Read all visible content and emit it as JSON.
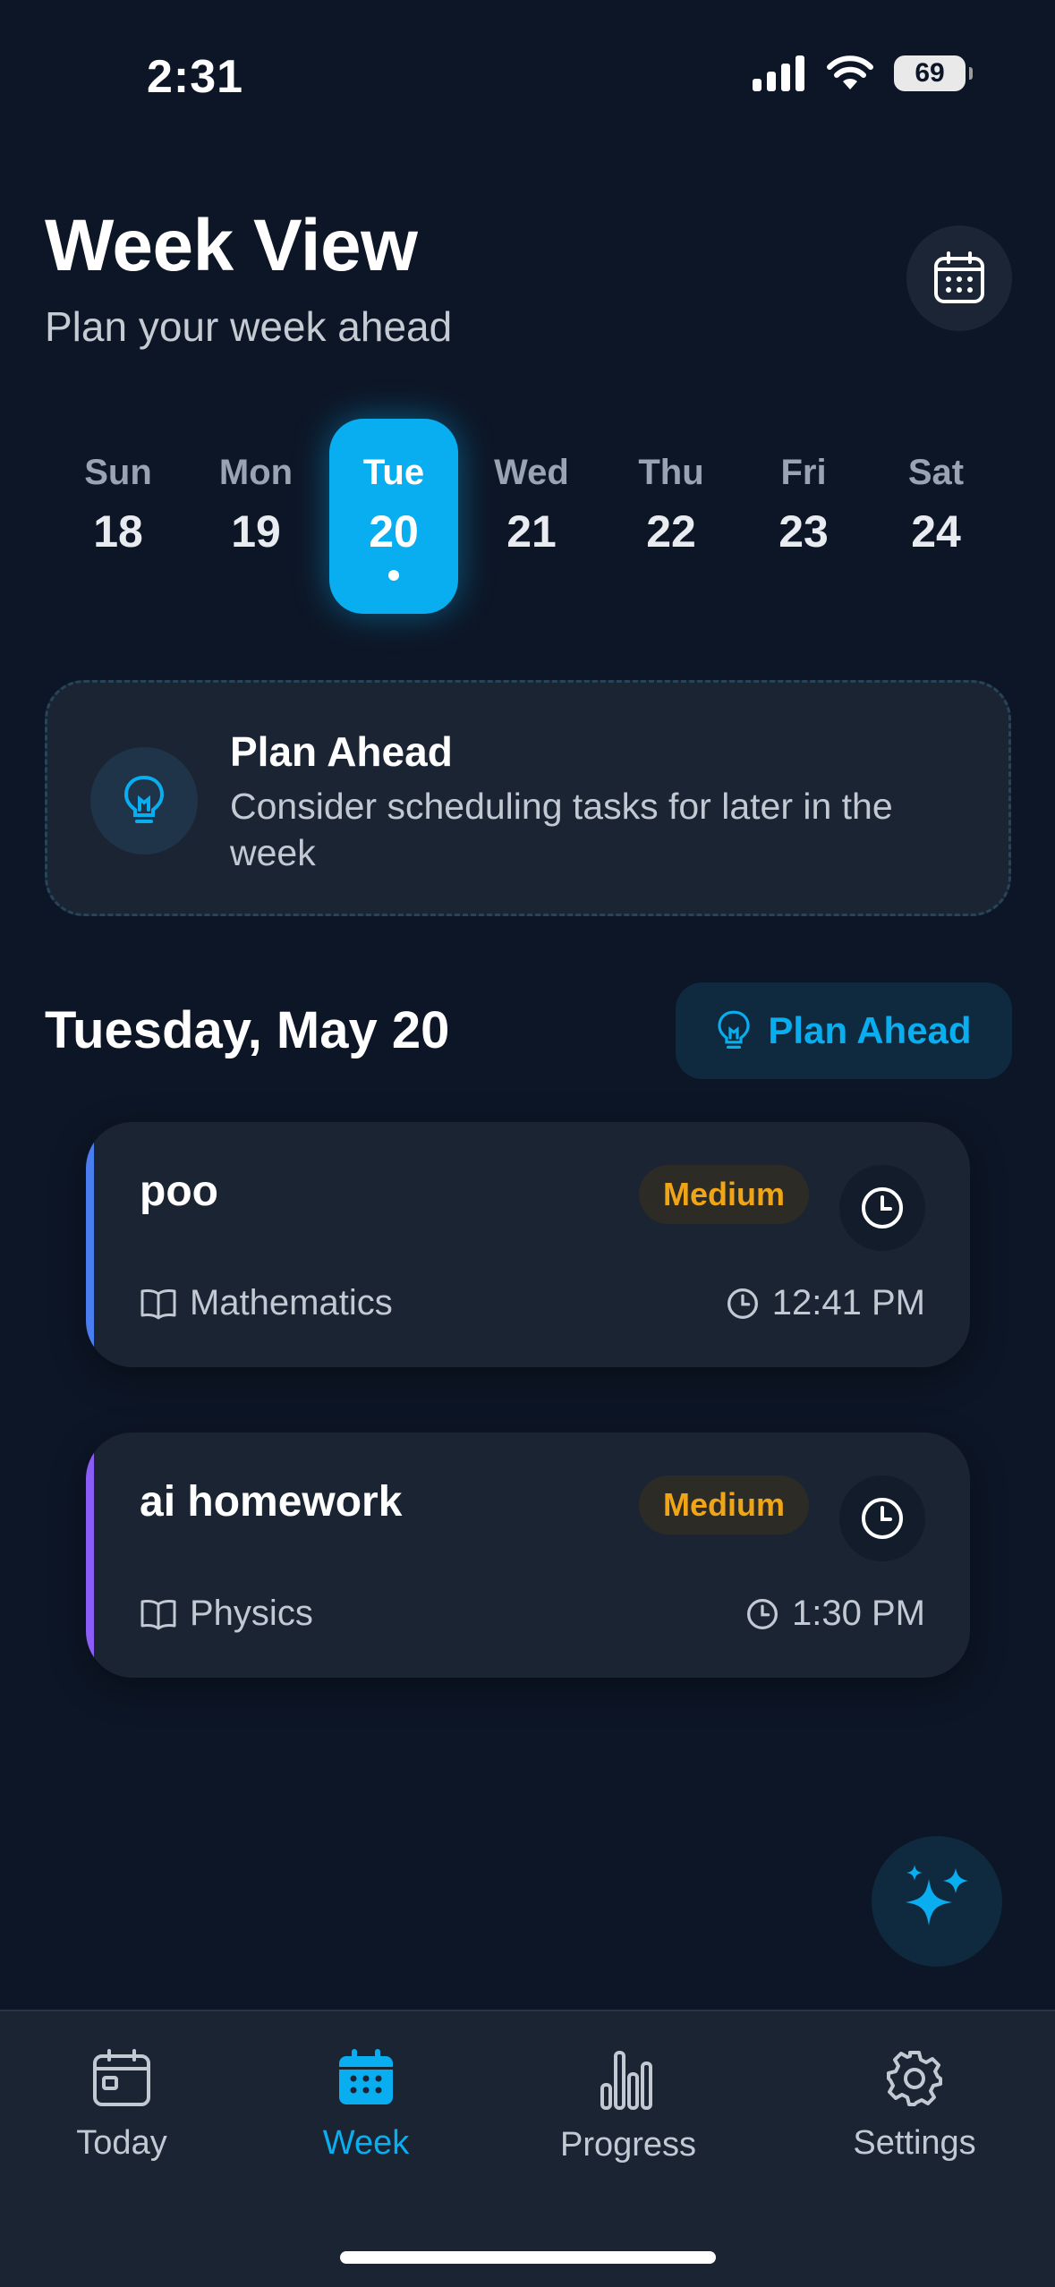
{
  "status_bar": {
    "time": "2:31",
    "battery": "69"
  },
  "header": {
    "title": "Week View",
    "subtitle": "Plan your week ahead"
  },
  "days": [
    {
      "name": "Sun",
      "num": "18"
    },
    {
      "name": "Mon",
      "num": "19"
    },
    {
      "name": "Tue",
      "num": "20"
    },
    {
      "name": "Wed",
      "num": "21"
    },
    {
      "name": "Thu",
      "num": "22"
    },
    {
      "name": "Fri",
      "num": "23"
    },
    {
      "name": "Sat",
      "num": "24"
    }
  ],
  "selected_day": "Tue",
  "tip": {
    "title": "Plan Ahead",
    "text": "Consider scheduling tasks for later in the week"
  },
  "section": {
    "title": "Tuesday, May 20",
    "button_label": "Plan Ahead"
  },
  "tasks": [
    {
      "title": "poo",
      "priority": "Medium",
      "subject": "Mathematics",
      "time": "12:41 PM",
      "accent": "#4a7df0"
    },
    {
      "title": "ai homework",
      "priority": "Medium",
      "subject": "Physics",
      "time": "1:30 PM",
      "accent": "#8b5cf6"
    }
  ],
  "tab_bar": {
    "tabs": [
      {
        "label": "Today"
      },
      {
        "label": "Week"
      },
      {
        "label": "Progress"
      },
      {
        "label": "Settings"
      }
    ],
    "active": "Week"
  },
  "colors": {
    "accent": "#09aef0",
    "background": "#0d1626",
    "card": "#1b2433",
    "priority_medium": "#f0a516"
  }
}
